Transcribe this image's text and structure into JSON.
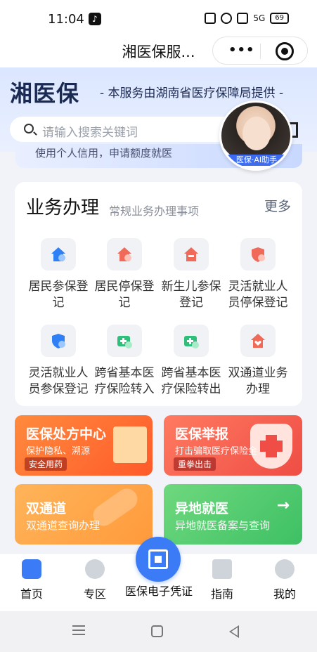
{
  "status_bar": {
    "time": "11:04",
    "battery": "69",
    "network": "5G"
  },
  "titlebar": {
    "title": "湘医保服..."
  },
  "hero": {
    "brand": "湘医保",
    "provider": "- 本服务由湖南省医疗保障局提供 -",
    "search_placeholder": "请输入搜索关键词",
    "banner_text": "使用个人信用，申请额度就医",
    "assistant_label": "医保·AI助手"
  },
  "services": {
    "title": "业务办理",
    "subtitle": "常规业务办理事项",
    "more": "更多",
    "items": [
      {
        "label": "居民参保登记",
        "icon": "house-check-icon"
      },
      {
        "label": "居民停保登记",
        "icon": "house-minus-icon"
      },
      {
        "label": "新生儿参保登记",
        "icon": "house-baby-icon"
      },
      {
        "label": "灵活就业人员停保登记",
        "icon": "shield-minus-icon"
      },
      {
        "label": "灵活就业人员参保登记",
        "icon": "shield-check-icon"
      },
      {
        "label": "跨省基本医疗保险转入",
        "icon": "medkit-in-icon"
      },
      {
        "label": "跨省基本医疗保险转出",
        "icon": "medkit-out-icon"
      },
      {
        "label": "双通道业务办理",
        "icon": "house-heart-icon"
      }
    ]
  },
  "promos": [
    {
      "title": "医保处方中心",
      "subtitle": "保护隐私、溯源",
      "badge": "安全用药"
    },
    {
      "title": "医保举报",
      "subtitle": "打击骗取医疗保险金",
      "badge": "重拳出击"
    },
    {
      "title": "双通道",
      "subtitle": "双通道查询办理",
      "badge": ""
    },
    {
      "title": "异地就医",
      "subtitle": "异地就医备案与查询",
      "badge": ""
    }
  ],
  "tabbar": {
    "items": [
      {
        "label": "首页"
      },
      {
        "label": "专区"
      },
      {
        "label": "医保电子凭证"
      },
      {
        "label": "指南"
      },
      {
        "label": "我的"
      }
    ]
  },
  "colors": {
    "primary": "#3b7cf6",
    "orange": "#ff5a2a",
    "red": "#ef4d45",
    "green": "#3ec064"
  }
}
